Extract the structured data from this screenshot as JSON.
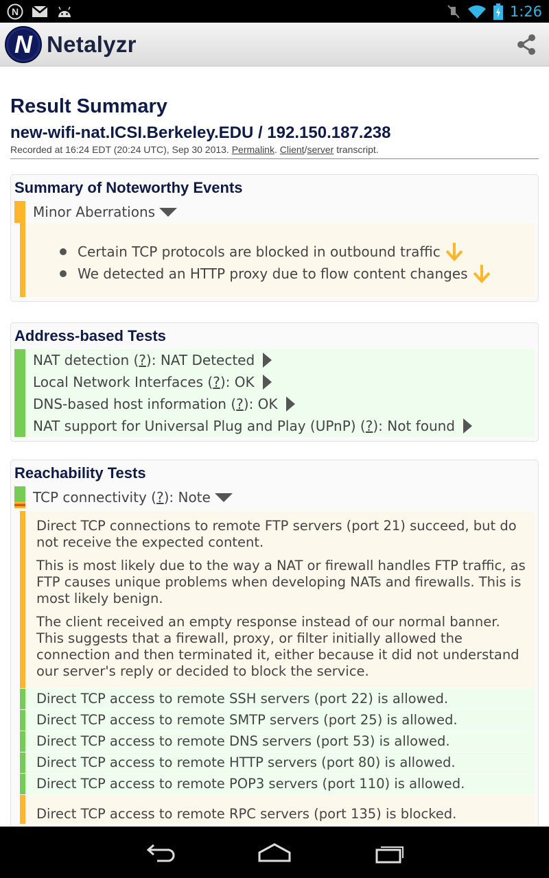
{
  "status_bar": {
    "time": "1:26",
    "left_icons": [
      "netalyzr-notification-icon",
      "gmail-icon",
      "android-icon"
    ],
    "right_icons": [
      "mute-icon",
      "wifi-icon",
      "battery-charging-icon"
    ]
  },
  "action_bar": {
    "title": "Netalyzr",
    "share_icon": "share-icon"
  },
  "header": {
    "title": "Result Summary",
    "host": "new-wifi-nat.ICSI.Berkeley.EDU / 192.150.187.238",
    "recorded_prefix": "Recorded at 16:24 EDT (20:24 UTC), Sep 30 2013. ",
    "permalink": "Permalink",
    "period": ". ",
    "client": "Client",
    "slash": "/",
    "server": "server",
    "transcript": " transcript."
  },
  "noteworthy": {
    "title": "Summary of Noteworthy Events",
    "group_label": "Minor Aberrations",
    "events": [
      "Certain TCP protocols are blocked in outbound traffic",
      "We detected an HTTP proxy due to flow content changes"
    ]
  },
  "address_tests": {
    "title": "Address-based Tests",
    "rows": [
      {
        "name": "NAT detection",
        "q": "?",
        "result": "NAT Detected"
      },
      {
        "name": "Local Network Interfaces",
        "q": "?",
        "result": "OK"
      },
      {
        "name": "DNS-based host information",
        "q": "?",
        "result": "OK"
      },
      {
        "name": "NAT support for Universal Plug and Play (UPnP)",
        "q": "?",
        "result": "Not found"
      }
    ]
  },
  "reachability": {
    "title": "Reachability Tests",
    "tcp_label": "TCP connectivity",
    "tcp_q": "?",
    "tcp_result": "Note",
    "paragraphs": [
      "Direct TCP connections to remote FTP servers (port 21) succeed, but do not receive the expected content.",
      "This is most likely due to the way a NAT or firewall handles FTP traffic, as FTP causes unique problems when developing NATs and firewalls. This is most likely benign.",
      "The client received an empty response instead of our normal banner. This suggests that a firewall, proxy, or filter initially allowed the connection and then terminated it, either because it did not understand our server's reply or decided to block the service."
    ],
    "ports": [
      {
        "text": "Direct TCP access to remote SSH servers (port 22) is allowed.",
        "status": "ok"
      },
      {
        "text": "Direct TCP access to remote SMTP servers (port 25) is allowed.",
        "status": "ok"
      },
      {
        "text": "Direct TCP access to remote DNS servers (port 53) is allowed.",
        "status": "ok"
      },
      {
        "text": "Direct TCP access to remote HTTP servers (port 80) is allowed.",
        "status": "ok"
      },
      {
        "text": "Direct TCP access to remote POP3 servers (port 110) is allowed.",
        "status": "ok"
      },
      {
        "text": "Direct TCP access to remote RPC servers (port 135) is blocked.",
        "status": "bad"
      }
    ]
  },
  "nav_bar": {
    "buttons": [
      "back-icon",
      "home-icon",
      "recent-apps-icon"
    ]
  },
  "colors": {
    "ok": "#77cc55",
    "warning": "#ffb52c",
    "title": "#0f1b47",
    "status_blue": "#33b5e5"
  }
}
